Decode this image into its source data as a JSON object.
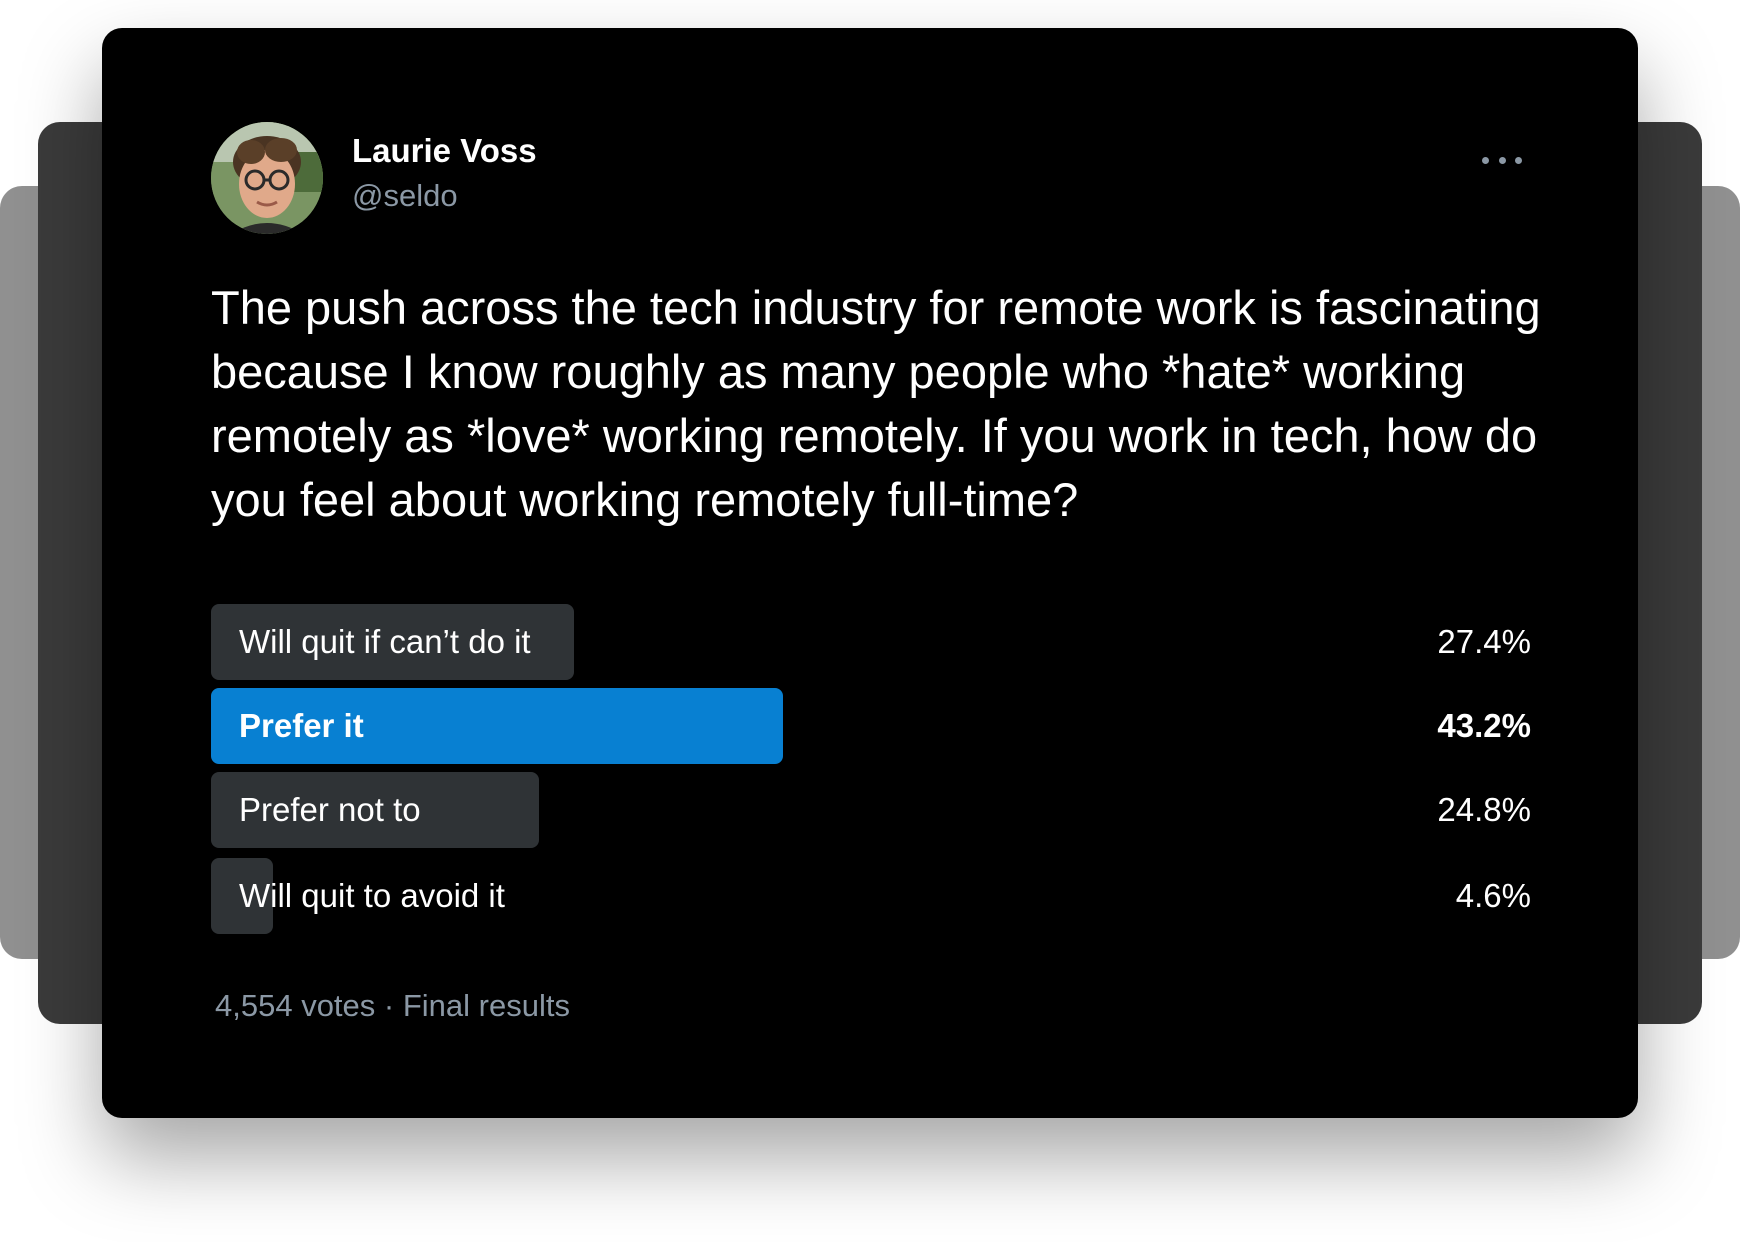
{
  "tweet": {
    "display_name": "Laurie Voss",
    "handle": "@seldo",
    "text": "The push across the tech industry for remote work is fascinating because I know roughly as many people who *hate* working remotely as *love* working remotely. If you work in tech, how do you feel about working remotely full-time?"
  },
  "poll": {
    "options": [
      {
        "label": "Will quit if can’t do it",
        "percent_text": "27.4%",
        "percent": 27.4,
        "winner": false
      },
      {
        "label": "Prefer it",
        "percent_text": "43.2%",
        "percent": 43.2,
        "winner": true
      },
      {
        "label": "Prefer not to",
        "percent_text": "24.8%",
        "percent": 24.8,
        "winner": false
      },
      {
        "label": "Will quit to avoid it",
        "percent_text": "4.6%",
        "percent": 4.6,
        "winner": false
      }
    ],
    "meta": "4,554 votes · Final results"
  },
  "colors": {
    "card_background": "#000000",
    "winner_bar": "#0880d2",
    "other_bar": "#2f3336",
    "secondary_text": "#8b98a5"
  },
  "icons": {
    "more": "more-horizontal-icon"
  }
}
